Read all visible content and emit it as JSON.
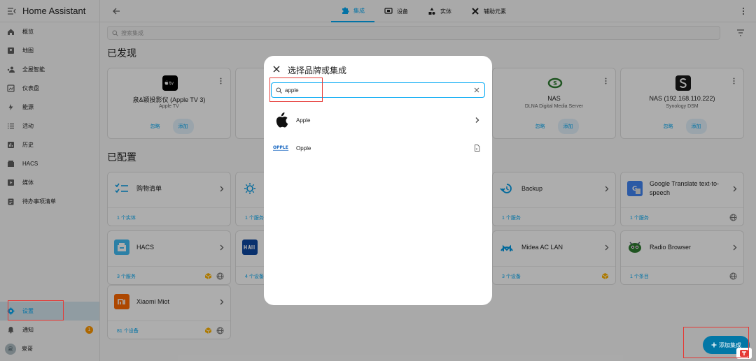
{
  "app": {
    "title": "Home Assistant"
  },
  "sidebar": {
    "items": [
      {
        "label": "概览"
      },
      {
        "label": "地图"
      },
      {
        "label": "全屋智能"
      },
      {
        "label": "仪表盘"
      },
      {
        "label": "能源"
      },
      {
        "label": "活动"
      },
      {
        "label": "历史"
      },
      {
        "label": "HACS"
      },
      {
        "label": "媒体"
      },
      {
        "label": "待办事项清单"
      }
    ],
    "settings_label": "设置",
    "notifications_label": "通知",
    "notifications_count": "1",
    "user_label": "泉哥",
    "user_avatar": "泉"
  },
  "tabs": [
    {
      "label": "集成"
    },
    {
      "label": "设备"
    },
    {
      "label": "实体"
    },
    {
      "label": "辅助元素"
    }
  ],
  "search": {
    "placeholder": "搜索集成"
  },
  "discovered": {
    "title": "已发现",
    "cards": [
      {
        "name": "泉&颖投影仪 (Apple TV 3)",
        "sub": "Apple TV",
        "ignore": "忽略",
        "add": "添加"
      },
      {
        "name": "NAS",
        "sub": "DLNA Digital Media Server",
        "ignore": "忽略",
        "add": "添加"
      },
      {
        "name": "NAS (192.168.110.222)",
        "sub": "Synology DSM",
        "ignore": "忽略",
        "add": "添加"
      }
    ]
  },
  "configured": {
    "title": "已配置",
    "cards": [
      {
        "name": "购物清单",
        "foot": "1 个实体"
      },
      {
        "name": "",
        "foot": "1 个服务"
      },
      {
        "name": "Backup",
        "foot": "1 个服务"
      },
      {
        "name": "Google Translate text-to-speech",
        "foot": "1 个服务"
      },
      {
        "name": "HACS",
        "foot": "3 个服务"
      },
      {
        "name": "",
        "foot": "4 个设备"
      },
      {
        "name": "Midea AC LAN",
        "foot": "3 个设备"
      },
      {
        "name": "Radio Browser",
        "foot": "1 个条目"
      },
      {
        "name": "Xiaomi Miot",
        "foot": "81 个设备"
      }
    ]
  },
  "dialog": {
    "title": "选择品牌或集成",
    "search_value": "apple",
    "results": [
      {
        "label": "Apple"
      },
      {
        "label": "Opple"
      }
    ]
  },
  "fab": {
    "label": "添加集成"
  },
  "colors": {
    "accent": "#03a9f4",
    "fab": "#0277a6",
    "highlight": "#e53935"
  }
}
